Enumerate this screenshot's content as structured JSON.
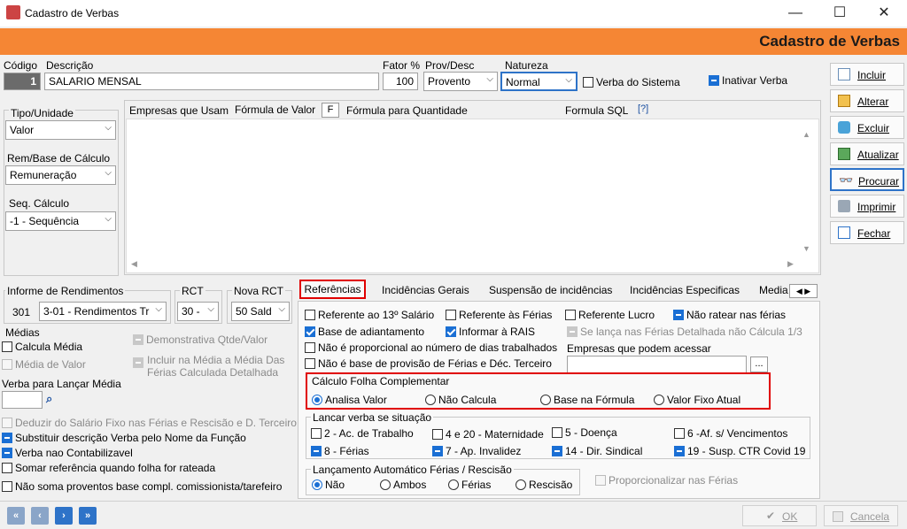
{
  "window": {
    "title": "Cadastro de Verbas",
    "controls": {
      "minimize": "—",
      "maximize": "☐",
      "close": "✕"
    }
  },
  "banner": {
    "title": "Cadastro de Verbas"
  },
  "header": {
    "codigo_label": "Código",
    "codigo_value": "1",
    "descricao_label": "Descrição",
    "descricao_value": "SALARIO MENSAL",
    "fator_label": "Fator %",
    "fator_value": "100",
    "provdesc_label": "Prov/Desc",
    "provdesc_value": "Provento",
    "natureza_label": "Natureza",
    "natureza_value": "Normal",
    "verba_sistema_label": "Verba do Sistema",
    "inativar_label": "Inativar Verba"
  },
  "left": {
    "tipo_label": "Tipo/Unidade",
    "tipo_value": "Valor",
    "rem_label": "Rem/Base de Cálculo",
    "rem_value": "Remuneração",
    "seq_label": "Seq. Cálculo",
    "seq_value": "-1 - Sequência"
  },
  "formula_tabs": {
    "empresas": "Empresas que Usam",
    "formula_valor": "Fórmula de Valor",
    "f_button": "F",
    "formula_qtd": "Fórmula para Quantidade",
    "formula_sql": "Formula SQL",
    "help_button": "[?]"
  },
  "side_buttons": [
    {
      "label": "Incluir"
    },
    {
      "label": "Alterar"
    },
    {
      "label": "Excluir"
    },
    {
      "label": "Atualizar"
    },
    {
      "label": "Procurar"
    },
    {
      "label": "Imprimir"
    },
    {
      "label": "Fechar"
    }
  ],
  "informe": {
    "label": "Informe de Rendimentos",
    "code": "301",
    "value": "3-01 - Rendimentos Tr",
    "rct_label": "RCT",
    "rct_value": "30 -",
    "nova_rct_label": "Nova RCT",
    "nova_rct_value": "50 Sald"
  },
  "medias": {
    "label": "Médias",
    "calcula_media": "Calcula Média",
    "demonstrativa": "Demonstrativa Qtde/Valor",
    "media_valor": "Média de Valor",
    "incluir_media_1": "Incluir na Média a Média Das",
    "incluir_media_2": "Férias Calculada Detalhada",
    "verba_lancar": "Verba para Lançar Média"
  },
  "bottom_left": {
    "deduzir": "Deduzir do Salário Fixo nas  Férias e Rescisão e D. Terceiro",
    "substituir": "Substituir descrição Verba pelo Nome da Função",
    "nao_contabil": "Verba nao Contabilizavel",
    "somar": "Somar referência quando folha for rateada",
    "nao_soma": "Não soma proventos base compl. comissionista/tarefeiro"
  },
  "tabs": [
    {
      "label": "Referências"
    },
    {
      "label": "Incidências Gerais"
    },
    {
      "label": "Suspensão de incidências"
    },
    {
      "label": "Incidências Especificas"
    },
    {
      "label": "Media"
    }
  ],
  "referencias": {
    "ref_13": "Referente ao 13º Salário",
    "ref_ferias": "Referente às Férias",
    "ref_lucro": "Referente Lucro",
    "nao_ratear": "Não ratear nas férias",
    "base_adiant": "Base de adiantamento",
    "informar_rais": "Informar à RAIS",
    "se_lanca": "Se lança nas Férias Detalhada não Cálcula 1/3",
    "nao_proporcional": "Não é proporcional ao número de dias trabalhados",
    "nao_base_prov": "Não é base de provisão de Férias e Déc. Terceiro",
    "empresas_acessar": "Empresas que podem acessar",
    "dots": "..."
  },
  "calculo_folha": {
    "label": "Cálculo Folha Complementar",
    "options": [
      "Analisa Valor",
      "Não Calcula",
      "Base na Fórmula",
      "Valor Fixo Atual"
    ]
  },
  "lancar_situacao": {
    "label": "Lancar verba se situação",
    "items": [
      "2 - Ac. de Trabalho",
      "4 e 20 - Maternidade",
      "5 - Doença",
      "6 -Af. s/ Vencimentos",
      "8 - Férias",
      "7 - Ap. Invalidez",
      "14  - Dir. Sindical",
      "19 - Susp. CTR Covid 19"
    ]
  },
  "lanc_auto": {
    "label": "Lançamento Automático Férias / Rescisão",
    "options": [
      "Não",
      "Ambos",
      "Férias",
      "Rescisão"
    ],
    "proporcionalizar": "Proporcionalizar nas Férias"
  },
  "footer": {
    "nav": [
      "«",
      "‹",
      "›",
      "»"
    ],
    "ok": "OK",
    "cancela": "Cancela"
  },
  "colors": {
    "accent": "#f58634",
    "check": "#1a6fd4",
    "highlight": "#e00000"
  },
  "icons": [
    "app-icon",
    "binoculars-icon",
    "chevron-down-icon"
  ]
}
